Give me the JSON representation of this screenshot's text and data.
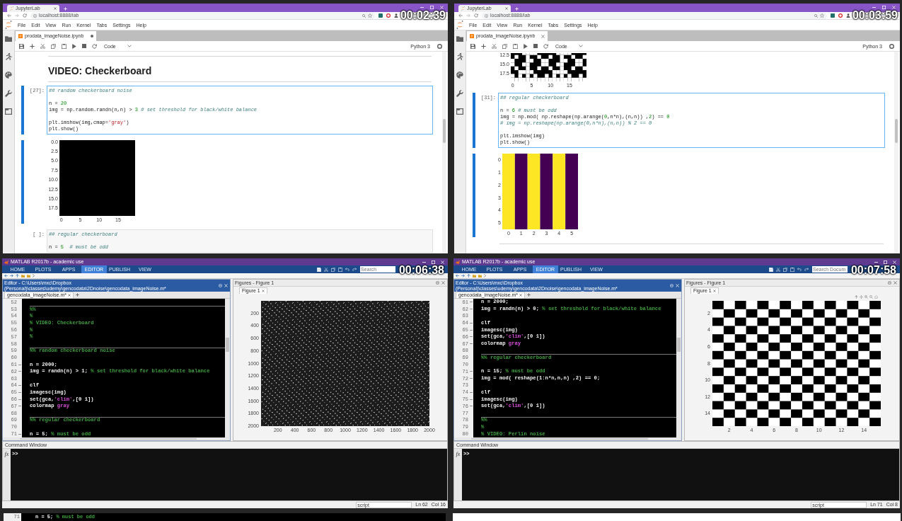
{
  "frames": [
    {
      "kind": "jupyter",
      "timestamp": "00:02:39",
      "browser": {
        "tab": "JupyterLab",
        "url": "localhost:8888/lab"
      },
      "menu": [
        "File",
        "Edit",
        "View",
        "Run",
        "Kernel",
        "Tabs",
        "Settings",
        "Help"
      ],
      "document_tab": {
        "title": "prodata_imageNoise.ipynb",
        "unsaved": true
      },
      "toolbar": {
        "cell_type": "Code",
        "kernel": "Python 3"
      },
      "cells": [
        {
          "kind": "rule"
        },
        {
          "kind": "heading",
          "text": "VIDEO: Checkerboard"
        },
        {
          "kind": "rule"
        },
        {
          "kind": "code",
          "prompt": "[27]:",
          "selected": true,
          "lines": [
            {
              "kind": "code",
              "segments": [
                {
                  "kind": "comment",
                  "text": "## random checkerboard noise"
                }
              ]
            },
            {
              "kind": "blank"
            },
            {
              "kind": "code",
              "segments": [
                {
                  "kind": "plain",
                  "text": "n = "
                },
                {
                  "kind": "number",
                  "text": "20"
                }
              ]
            },
            {
              "kind": "code",
              "segments": [
                {
                  "kind": "plain",
                  "text": "img = np.random.randn(n,n) > "
                },
                {
                  "kind": "number",
                  "text": "3"
                },
                {
                  "kind": "comment",
                  "text": " # set threshold for black/white balance"
                }
              ]
            },
            {
              "kind": "blank"
            },
            {
              "kind": "code",
              "segments": [
                {
                  "kind": "plain",
                  "text": "plt.imshow(img,cmap="
                },
                {
                  "kind": "string",
                  "text": "'gray'"
                },
                {
                  "kind": "plain",
                  "text": ")"
                }
              ]
            },
            {
              "kind": "code",
              "segments": [
                {
                  "kind": "plain",
                  "text": "plt.show()"
                }
              ]
            }
          ]
        },
        {
          "kind": "output",
          "selected": true,
          "plot": {
            "kind": "blank",
            "yticks": [
              "0.0",
              "2.5",
              "5.0",
              "7.5",
              "10.0",
              "12.5",
              "15.0",
              "17.5"
            ],
            "xticks": [
              "0",
              "5",
              "10",
              "15"
            ]
          }
        },
        {
          "kind": "code",
          "prompt": "[ ]:",
          "selected": false,
          "lines": [
            {
              "kind": "code",
              "segments": [
                {
                  "kind": "comment",
                  "text": "## regular checkerboard"
                }
              ]
            },
            {
              "kind": "blank"
            },
            {
              "kind": "code",
              "segments": [
                {
                  "kind": "plain",
                  "text": "n = "
                },
                {
                  "kind": "number",
                  "text": "5"
                },
                {
                  "kind": "comment",
                  "text": "  # must be odd"
                }
              ]
            }
          ]
        }
      ]
    },
    {
      "kind": "jupyter",
      "timestamp": "00:03:59",
      "browser": {
        "tab": "JupyterLab",
        "url": "localhost:8888/lab"
      },
      "menu": [
        "File",
        "Edit",
        "View",
        "Run",
        "Kernel",
        "Tabs",
        "Settings",
        "Help"
      ],
      "document_tab": {
        "title": "prodata_imageNoise.ipynb",
        "unsaved": false
      },
      "toolbar": {
        "cell_type": "Code",
        "kernel": "Python 3"
      },
      "cells": [
        {
          "kind": "output",
          "selected": false,
          "plot": {
            "kind": "noise",
            "cut_off": true,
            "yticks": [
              "12.5",
              "15.0",
              "17.5"
            ],
            "xticks": [
              "0",
              "5",
              "10",
              "15"
            ]
          }
        },
        {
          "kind": "code",
          "prompt": "[31]:",
          "selected": true,
          "lines": [
            {
              "kind": "code",
              "segments": [
                {
                  "kind": "comment",
                  "text": "## regular checkerboard"
                }
              ]
            },
            {
              "kind": "blank"
            },
            {
              "kind": "code",
              "segments": [
                {
                  "kind": "plain",
                  "text": "n = "
                },
                {
                  "kind": "number",
                  "text": "6"
                },
                {
                  "kind": "comment",
                  "text": " # must be odd"
                }
              ]
            },
            {
              "kind": "code",
              "segments": [
                {
                  "kind": "plain",
                  "text": "img = np.mod( np.reshape(np.arange("
                },
                {
                  "kind": "number",
                  "text": "0"
                },
                {
                  "kind": "plain",
                  "text": ",n*n),(n,n)) ,"
                },
                {
                  "kind": "number",
                  "text": "2"
                },
                {
                  "kind": "plain",
                  "text": ") == "
                },
                {
                  "kind": "number",
                  "text": "0"
                }
              ]
            },
            {
              "kind": "code",
              "segments": [
                {
                  "kind": "comment",
                  "text": "# img = np.reshape(np.arange(0,n*n),(n,n)) % 2 == 0"
                }
              ]
            },
            {
              "kind": "blank"
            },
            {
              "kind": "code",
              "segments": [
                {
                  "kind": "plain",
                  "text": "plt.imshow(img)"
                }
              ]
            },
            {
              "kind": "code",
              "segments": [
                {
                  "kind": "plain",
                  "text": "plt.show()"
                }
              ]
            }
          ]
        },
        {
          "kind": "output",
          "selected": true,
          "plot": {
            "kind": "stripes",
            "yticks": [
              "0",
              "1",
              "2",
              "3",
              "4",
              "5"
            ],
            "xticks": [
              "0",
              "1",
              "2",
              "3",
              "4",
              "5"
            ]
          }
        },
        {
          "kind": "rule"
        }
      ]
    },
    {
      "kind": "matlab",
      "timestamp": "00:06:38",
      "window_title": "MATLAB R2017b - academic use",
      "ribbon_tabs": [
        {
          "label": "HOME",
          "selected": false
        },
        {
          "label": "PLOTS",
          "selected": false
        },
        {
          "label": "APPS",
          "selected": false
        },
        {
          "label": "EDITOR",
          "selected": true
        },
        {
          "label": "PUBLISH",
          "selected": false
        },
        {
          "label": "VIEW",
          "selected": false
        }
      ],
      "search": {
        "placeholder": "Search"
      },
      "editor": {
        "title": "Editor - C:\\Users\\mxc\\Dropbox (Personal)\\classes\\udemy\\gencodata\\2Dnoise\\gencodata_imageNoise.m*",
        "tab": "gencodata_imageNoise.m*",
        "lines": [
          {
            "number": "52",
            "section": false,
            "runnable": false
          },
          {
            "number": "53",
            "section": true,
            "runnable": false,
            "segments": [
              {
                "kind": "comment",
                "text": "%%"
              }
            ]
          },
          {
            "number": "54",
            "section": false,
            "runnable": false,
            "segments": [
              {
                "kind": "comment",
                "text": "%"
              }
            ]
          },
          {
            "number": "55",
            "section": false,
            "runnable": false,
            "segments": [
              {
                "kind": "comment",
                "text": "% VIDEO: Checkerboard"
              }
            ]
          },
          {
            "number": "56",
            "section": false,
            "runnable": false,
            "segments": [
              {
                "kind": "comment",
                "text": "%"
              }
            ]
          },
          {
            "number": "57",
            "section": false,
            "runnable": false,
            "segments": [
              {
                "kind": "comment",
                "text": "%"
              }
            ]
          },
          {
            "number": "58",
            "section": false,
            "runnable": false
          },
          {
            "number": "59",
            "section": true,
            "runnable": false,
            "segments": [
              {
                "kind": "comment",
                "text": "%% random checkerboard noise"
              }
            ]
          },
          {
            "number": "60",
            "section": false,
            "runnable": false
          },
          {
            "number": "61",
            "section": false,
            "runnable": true,
            "segments": [
              {
                "kind": "plain",
                "text": "n = 2000;"
              }
            ]
          },
          {
            "number": "62",
            "section": false,
            "runnable": true,
            "segments": [
              {
                "kind": "plain",
                "text": "img = randn(n) > 1; "
              },
              {
                "kind": "comment",
                "text": "% set threshold for black/white balance"
              }
            ]
          },
          {
            "number": "63",
            "section": false,
            "runnable": false
          },
          {
            "number": "64",
            "section": false,
            "runnable": true,
            "segments": [
              {
                "kind": "plain",
                "text": "clf"
              }
            ]
          },
          {
            "number": "65",
            "section": false,
            "runnable": true,
            "segments": [
              {
                "kind": "plain",
                "text": "imagesc(img)"
              }
            ]
          },
          {
            "number": "66",
            "section": false,
            "runnable": true,
            "segments": [
              {
                "kind": "plain",
                "text": "set(gca,"
              },
              {
                "kind": "string",
                "text": "'clim'"
              },
              {
                "kind": "plain",
                "text": ",[0 1])"
              }
            ]
          },
          {
            "number": "67",
            "section": false,
            "runnable": true,
            "segments": [
              {
                "kind": "plain",
                "text": "colormap "
              },
              {
                "kind": "string",
                "text": "gray"
              }
            ]
          },
          {
            "number": "68",
            "section": false,
            "runnable": false
          },
          {
            "number": "69",
            "section": true,
            "runnable": false,
            "segments": [
              {
                "kind": "comment",
                "text": "%% regular checkerboard"
              }
            ]
          },
          {
            "number": "70",
            "section": false,
            "runnable": false
          },
          {
            "number": "71",
            "section": false,
            "runnable": true,
            "segments": [
              {
                "kind": "plain",
                "text": "n = 5; "
              },
              {
                "kind": "comment",
                "text": "% must be odd"
              }
            ]
          }
        ]
      },
      "figures": {
        "title": "Figures - Figure 1",
        "tab": "Figure 1",
        "axes_toolbar": false,
        "plot": {
          "kind": "speckle",
          "yticks": [
            "200",
            "400",
            "600",
            "800",
            "1000",
            "1200",
            "1400",
            "1600",
            "1800",
            "2000"
          ],
          "xticks": [
            "200",
            "400",
            "600",
            "800",
            "1000",
            "1200",
            "1400",
            "1600",
            "1800",
            "2000"
          ]
        }
      },
      "command_window": {
        "title": "Command Window",
        "function_button": "fx",
        "prompt": ">>"
      },
      "status": {
        "file_type": "script",
        "line": "Ln 62",
        "column": "Col 16"
      }
    },
    {
      "kind": "matlab",
      "timestamp": "00:07:58",
      "window_title": "MATLAB R2017b - academic use",
      "ribbon_tabs": [
        {
          "label": "HOME",
          "selected": false
        },
        {
          "label": "PLOTS",
          "selected": false
        },
        {
          "label": "APPS",
          "selected": false
        },
        {
          "label": "EDITOR",
          "selected": true
        },
        {
          "label": "PUBLISH",
          "selected": false
        },
        {
          "label": "VIEW",
          "selected": false
        }
      ],
      "search": {
        "placeholder": "Search Docum"
      },
      "editor": {
        "title": "Editor - C:\\Users\\mxc\\Dropbox (Personal)\\classes\\udemy\\gencodata\\2Dnoise\\gencodata_imageNoise.m*",
        "tab": "gencodata_imageNoise.m*",
        "lines": [
          {
            "number": "61",
            "section": false,
            "runnable": true,
            "segments": [
              {
                "kind": "plain",
                "text": "n = 2000;"
              }
            ]
          },
          {
            "number": "62",
            "section": false,
            "runnable": true,
            "segments": [
              {
                "kind": "plain",
                "text": "img = randn(n) > 0; "
              },
              {
                "kind": "comment",
                "text": "% set threshold for black/white balance"
              }
            ]
          },
          {
            "number": "63",
            "section": false,
            "runnable": false
          },
          {
            "number": "64",
            "section": false,
            "runnable": true,
            "segments": [
              {
                "kind": "plain",
                "text": "clf"
              }
            ]
          },
          {
            "number": "65",
            "section": false,
            "runnable": true,
            "segments": [
              {
                "kind": "plain",
                "text": "imagesc(img)"
              }
            ]
          },
          {
            "number": "66",
            "section": false,
            "runnable": true,
            "segments": [
              {
                "kind": "plain",
                "text": "set(gca,"
              },
              {
                "kind": "string",
                "text": "'clim'"
              },
              {
                "kind": "plain",
                "text": ",[0 1])"
              }
            ]
          },
          {
            "number": "67",
            "section": false,
            "runnable": true,
            "segments": [
              {
                "kind": "plain",
                "text": "colormap "
              },
              {
                "kind": "string",
                "text": "gray"
              }
            ]
          },
          {
            "number": "68",
            "section": false,
            "runnable": false
          },
          {
            "number": "69",
            "section": true,
            "runnable": false,
            "segments": [
              {
                "kind": "comment",
                "text": "%% regular checkerboard"
              }
            ]
          },
          {
            "number": "70",
            "section": false,
            "runnable": false
          },
          {
            "number": "71",
            "section": false,
            "runnable": true,
            "segments": [
              {
                "kind": "plain",
                "text": "n = 15; "
              },
              {
                "kind": "comment",
                "text": "% must be odd"
              }
            ]
          },
          {
            "number": "72",
            "section": false,
            "runnable": true,
            "segments": [
              {
                "kind": "plain",
                "text": "img = mod( reshape(1:n*n,n,n) ,2) == 0;"
              }
            ]
          },
          {
            "number": "73",
            "section": false,
            "runnable": false
          },
          {
            "number": "74",
            "section": false,
            "runnable": true,
            "segments": [
              {
                "kind": "plain",
                "text": "clf"
              }
            ]
          },
          {
            "number": "75",
            "section": false,
            "runnable": true,
            "segments": [
              {
                "kind": "plain",
                "text": "imagesc(img)"
              }
            ]
          },
          {
            "number": "76",
            "section": false,
            "runnable": true,
            "segments": [
              {
                "kind": "plain",
                "text": "set(gca,"
              },
              {
                "kind": "string",
                "text": "'clim'"
              },
              {
                "kind": "plain",
                "text": ",[0 1])"
              }
            ]
          },
          {
            "number": "77",
            "section": false,
            "runnable": false
          },
          {
            "number": "78",
            "section": true,
            "runnable": false,
            "segments": [
              {
                "kind": "comment",
                "text": "%%"
              }
            ]
          },
          {
            "number": "79",
            "section": false,
            "runnable": false,
            "segments": [
              {
                "kind": "comment",
                "text": "%"
              }
            ]
          },
          {
            "number": "80",
            "section": false,
            "runnable": false,
            "segments": [
              {
                "kind": "comment",
                "text": "% VIDEO: Perlin noise"
              }
            ]
          }
        ]
      },
      "figures": {
        "title": "Figures - Figure 1",
        "tab": "Figure 1",
        "axes_toolbar": true,
        "plot": {
          "kind": "checkerboard",
          "yticks": [
            "2",
            "4",
            "6",
            "8",
            "10",
            "12",
            "14"
          ],
          "xticks": [
            "2",
            "4",
            "6",
            "8",
            "10",
            "12",
            "14"
          ]
        }
      },
      "command_window": {
        "title": "Command Window",
        "function_button": "fx",
        "prompt": ">>"
      },
      "status": {
        "file_type": "script",
        "line": "Ln 71",
        "column": "Col 8"
      }
    }
  ],
  "partial_frames": [
    {
      "kind": "editor",
      "number": "71",
      "segments": [
        {
          "kind": "plain",
          "text": "n = 5; "
        },
        {
          "kind": "comment",
          "text": "% must be odd"
        }
      ]
    },
    {
      "kind": "blank"
    }
  ]
}
